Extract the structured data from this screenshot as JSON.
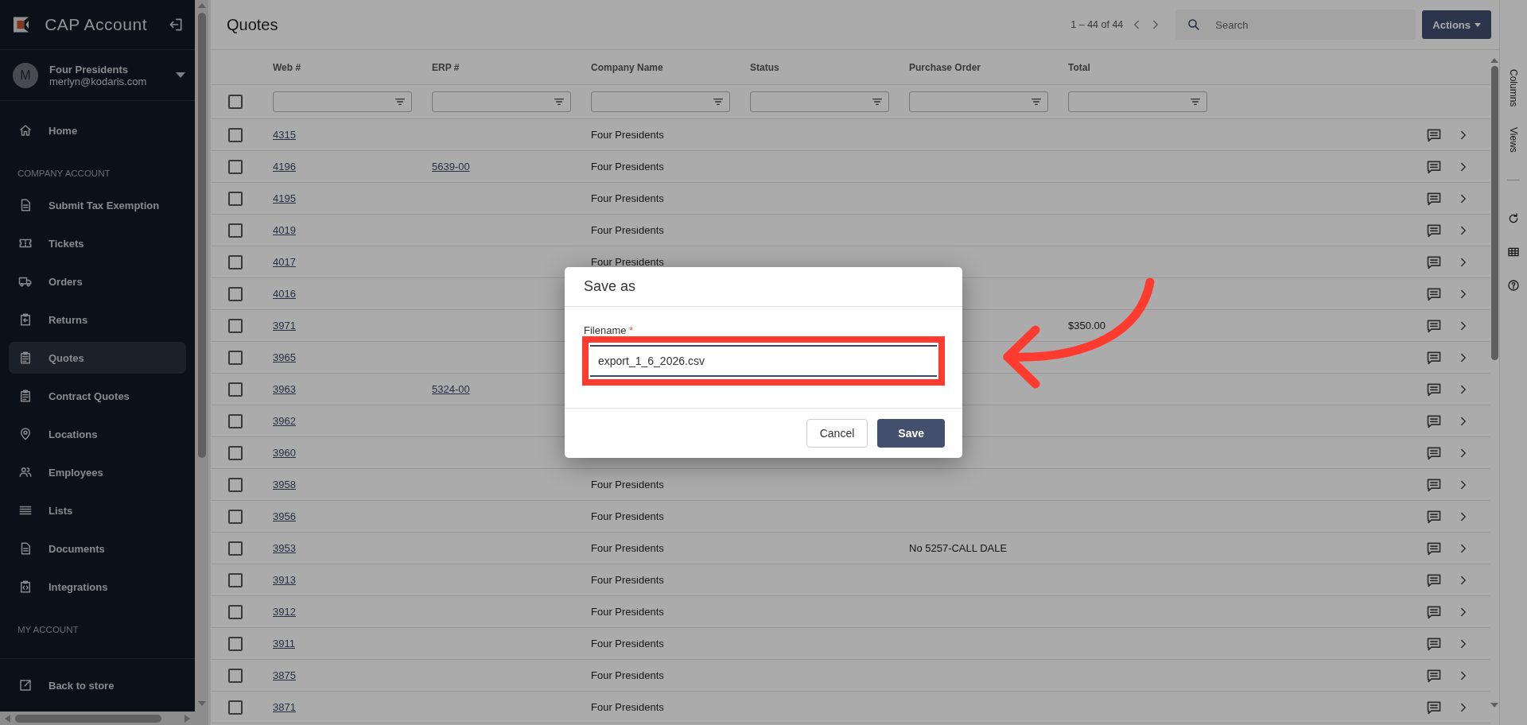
{
  "sidebar": {
    "brand": "CAP Account",
    "user": {
      "initial": "M",
      "name": "Four Presidents",
      "email": "merlyn@kodaris.com"
    },
    "nav": [
      {
        "kind": "item",
        "label": "Home",
        "selected": false
      },
      {
        "kind": "heading",
        "label": "COMPANY ACCOUNT"
      },
      {
        "kind": "item",
        "label": "Submit Tax Exemption",
        "selected": false
      },
      {
        "kind": "item",
        "label": "Tickets",
        "selected": false
      },
      {
        "kind": "item",
        "label": "Orders",
        "selected": false
      },
      {
        "kind": "item",
        "label": "Returns",
        "selected": false
      },
      {
        "kind": "item",
        "label": "Quotes",
        "selected": true
      },
      {
        "kind": "item",
        "label": "Contract Quotes",
        "selected": false
      },
      {
        "kind": "item",
        "label": "Locations",
        "selected": false
      },
      {
        "kind": "item",
        "label": "Employees",
        "selected": false
      },
      {
        "kind": "item",
        "label": "Lists",
        "selected": false
      },
      {
        "kind": "item",
        "label": "Documents",
        "selected": false
      },
      {
        "kind": "item",
        "label": "Integrations",
        "selected": false
      },
      {
        "kind": "heading",
        "label": "MY ACCOUNT"
      }
    ],
    "footer_link": "Back to store"
  },
  "page": {
    "title": "Quotes",
    "pager": "1 – 44 of 44",
    "search": {
      "placeholder": "Search"
    },
    "actions_button": "Actions"
  },
  "table": {
    "columns": [
      "Web #",
      "ERP #",
      "Company Name",
      "Status",
      "Purchase Order",
      "Total"
    ],
    "select_all": {
      "checked": false
    },
    "rows": [
      {
        "checked": false,
        "web": "4315",
        "company": "Four Presidents"
      },
      {
        "checked": false,
        "web": "4196",
        "erp": "5639-00",
        "company": "Four Presidents"
      },
      {
        "checked": false,
        "web": "4195",
        "company": "Four Presidents"
      },
      {
        "checked": false,
        "web": "4019",
        "company": "Four Presidents"
      },
      {
        "checked": false,
        "web": "4017",
        "company": "Four Presidents"
      },
      {
        "checked": false,
        "web": "4016"
      },
      {
        "checked": false,
        "web": "3971",
        "total": "$350.00"
      },
      {
        "checked": false,
        "web": "3965"
      },
      {
        "checked": false,
        "web": "3963",
        "erp": "5324-00"
      },
      {
        "checked": false,
        "web": "3962"
      },
      {
        "checked": false,
        "web": "3960"
      },
      {
        "checked": false,
        "web": "3958",
        "company": "Four Presidents"
      },
      {
        "checked": false,
        "web": "3956",
        "company": "Four Presidents"
      },
      {
        "checked": false,
        "web": "3953",
        "company": "Four Presidents",
        "purchase_order": "No 5257-CALL DALE"
      },
      {
        "checked": false,
        "web": "3913",
        "company": "Four Presidents"
      },
      {
        "checked": false,
        "web": "3912",
        "company": "Four Presidents"
      },
      {
        "checked": false,
        "web": "3911",
        "company": "Four Presidents"
      },
      {
        "checked": false,
        "web": "3875",
        "company": "Four Presidents"
      },
      {
        "checked": false,
        "web": "3871",
        "company": "Four Presidents"
      }
    ]
  },
  "side_panel": {
    "tabs": [
      "Columns",
      "Views"
    ]
  },
  "dialog": {
    "title": "Save as",
    "field": {
      "label": "Filename",
      "required_mark": "*",
      "value": "export_1_6_2026.csv"
    },
    "buttons": [
      {
        "label": "Cancel",
        "kind": "secondary"
      },
      {
        "label": "Save",
        "kind": "primary"
      }
    ]
  }
}
